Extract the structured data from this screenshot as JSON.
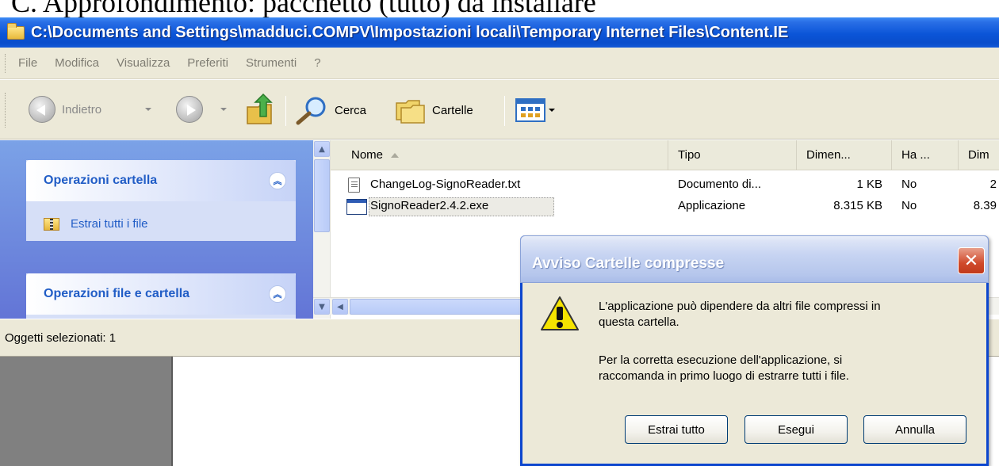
{
  "caption": "C. Approfondimento: pacchetto (tutto) da installare",
  "window": {
    "title": "C:\\Documents and Settings\\madduci.COMPV\\Impostazioni locali\\Temporary Internet Files\\Content.IE"
  },
  "menu": [
    "File",
    "Modifica",
    "Visualizza",
    "Preferiti",
    "Strumenti",
    "?"
  ],
  "toolbar": {
    "back_label": "Indietro",
    "search_label": "Cerca",
    "folders_label": "Cartelle"
  },
  "tasks": {
    "folder_ops_title": "Operazioni cartella",
    "extract_all_label": "Estrai tutti i file",
    "file_ops_title": "Operazioni file e cartella"
  },
  "columns": {
    "name": "Nome",
    "type": "Tipo",
    "size": "Dimen...",
    "has": "Ha ...",
    "dim": "Dim"
  },
  "files": [
    {
      "name": "ChangeLog-SignoReader.txt",
      "type": "Documento di...",
      "size": "1 KB",
      "has": "No",
      "dim": "2",
      "icon": "text-file-icon"
    },
    {
      "name": "SignoReader2.4.2.exe",
      "type": "Applicazione",
      "size": "8.315 KB",
      "has": "No",
      "dim": "8.39",
      "icon": "application-icon"
    }
  ],
  "status": {
    "text": "Oggetti selezionati: 1"
  },
  "dialog": {
    "title": "Avviso Cartelle compresse",
    "message_line1": "L'applicazione può dipendere da altri file compressi in",
    "message_line2": "questa cartella.",
    "message_line3": "Per la corretta esecuzione dell'applicazione, si",
    "message_line4": "raccomanda in primo luogo di estrarre tutti i file.",
    "extract_button": "Estrai tutto",
    "run_button": "Esegui",
    "cancel_button": "Annulla",
    "close_glyph": "✕"
  }
}
